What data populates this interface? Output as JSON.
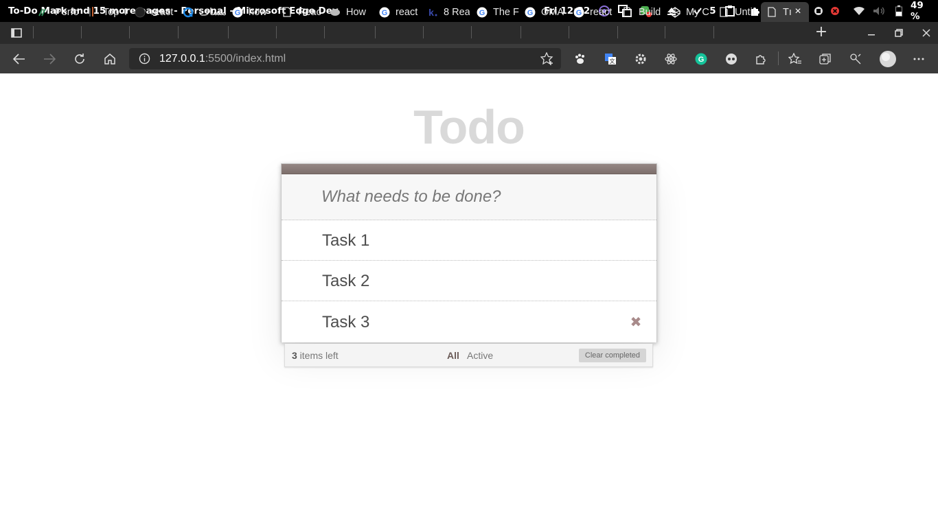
{
  "os": {
    "window_title": "To-Do Mark and 15 more pages - Personal - Microsoft Edge Dev",
    "clock": "Fri 12:32",
    "tray_checks": "5",
    "language": "en",
    "battery": "49 %"
  },
  "tabs": [
    {
      "label": "Perfo"
    },
    {
      "label": "Top 4"
    },
    {
      "label": "react"
    },
    {
      "label": "مساف"
    },
    {
      "label": "how"
    },
    {
      "label": "Reac"
    },
    {
      "label": "How"
    },
    {
      "label": "react"
    },
    {
      "label": "8 Rea"
    },
    {
      "label": "The F"
    },
    {
      "label": "OMA"
    },
    {
      "label": "react"
    },
    {
      "label": "Build"
    },
    {
      "label": "My C"
    },
    {
      "label": "Untit"
    },
    {
      "label": "Tı"
    }
  ],
  "address": {
    "host": "127.0.0.1",
    "rest": ":5500/index.html"
  },
  "app": {
    "title": "Todo",
    "new_todo_placeholder": "What needs to be done?",
    "todos": [
      {
        "label": "Task 1"
      },
      {
        "label": "Task 2"
      },
      {
        "label": "Task 3"
      }
    ],
    "count": "3",
    "count_suffix": " items left",
    "filters": {
      "all": "All",
      "active": "Active"
    },
    "clear_completed": "Clear completed",
    "destroy_icon": "✖"
  },
  "colors": {
    "accent": "#8d7d7a",
    "title": "#d9d9d9",
    "destroy": "#a88a8a"
  }
}
